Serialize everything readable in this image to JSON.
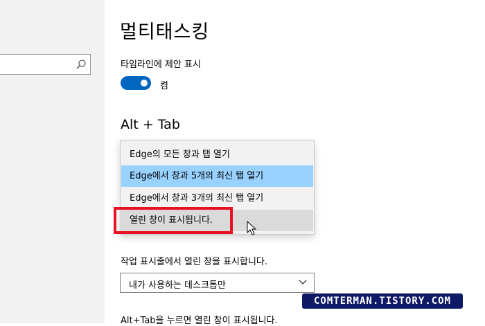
{
  "search": {
    "placeholder": "",
    "icon": "search-icon"
  },
  "page": {
    "title": "멀티태스킹",
    "timeline": {
      "label": "타임라인에 제안 표시",
      "toggle_state": "켬",
      "toggle_on": true
    }
  },
  "alt_tab": {
    "title": "Alt + Tab",
    "options": [
      "Edge의 모든 창과 탭 열기",
      "Edge에서 창과 5개의 최신 탭 열기",
      "Edge에서 창과 3개의 최신 탭 열기",
      "열린 창이 표시됩니다."
    ],
    "selected_index": 1,
    "hovered_index": 3
  },
  "taskbar": {
    "label": "작업 표시줄에서 열린 창을 표시합니다.",
    "selected": "내가 사용하는 데스크톱만"
  },
  "bottom": {
    "text": "Alt+Tab을 누르면 열린 창이 표시됩니다."
  },
  "watermark": "COMTERMAN.TISTORY.COM",
  "colors": {
    "accent": "#0067c0",
    "selected": "#99d1ff",
    "highlight": "#e81123",
    "watermark_bg": "#0f1a66"
  }
}
